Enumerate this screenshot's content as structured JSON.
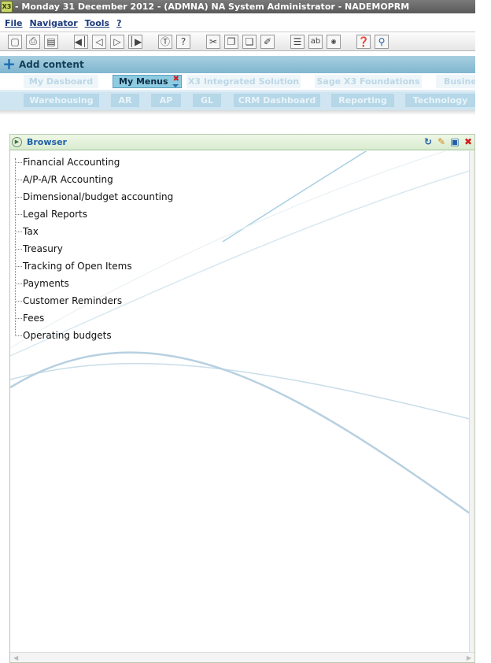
{
  "window": {
    "title": "- Monday 31 December 2012 - (ADMNA) NA System Administrator - NADEMOPRM",
    "app_icon_text": "X3"
  },
  "menubar": {
    "items": [
      "File",
      "Navigator",
      "Tools",
      "?"
    ]
  },
  "toolbar": {
    "icons": [
      "new-page-icon",
      "print-icon",
      "print-preview-icon",
      "first-icon",
      "previous-icon",
      "next-icon",
      "last-icon",
      "attach-icon",
      "help-icon",
      "cut-icon",
      "copy-icon",
      "paste-icon",
      "sign-icon",
      "list-icon",
      "text-icon",
      "x3-icon",
      "question-icon",
      "search-icon"
    ]
  },
  "addbar": {
    "label": "Add content"
  },
  "tabs_row1": [
    {
      "label": "My Dasboard",
      "active": false
    },
    {
      "label": "My Menus",
      "active": true
    },
    {
      "label": "X3 Integrated Solution",
      "active": false
    },
    {
      "label": "Sage X3 Foundations",
      "active": false
    },
    {
      "label": "Busines",
      "active": false
    }
  ],
  "tabs_row2": [
    {
      "label": "Warehousing"
    },
    {
      "label": "AR"
    },
    {
      "label": "AP"
    },
    {
      "label": "GL"
    },
    {
      "label": "CRM Dashboard"
    },
    {
      "label": "Reporting"
    },
    {
      "label": "Technology"
    }
  ],
  "panel": {
    "title": "Browser",
    "header_icons": [
      "refresh-icon",
      "edit-icon",
      "maximize-icon",
      "close-icon"
    ]
  },
  "tree": {
    "items": [
      "Financial Accounting",
      "A/P-A/R Accounting",
      "Dimensional/budget accounting",
      "Legal Reports",
      "Tax",
      "Treasury",
      "Tracking of Open Items",
      "Payments",
      "Customer Reminders",
      "Fees",
      "Operating budgets"
    ]
  },
  "colors": {
    "accent": "#1f5fa8",
    "addbar": "#8fc0d6",
    "active_tab": "#8ccbe0",
    "panel_border": "#b9c9b0"
  }
}
